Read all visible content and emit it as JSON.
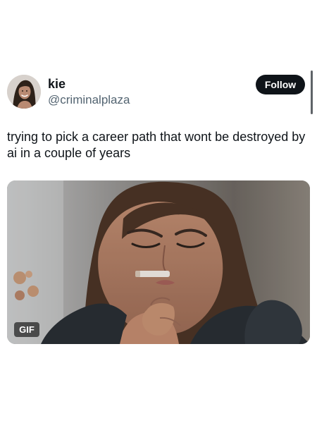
{
  "author": {
    "name": "kie",
    "handle": "@criminalplaza"
  },
  "actions": {
    "follow_label": "Follow"
  },
  "tweet": {
    "text": "trying to pick a career path that wont be destroyed by ai in a couple of years"
  },
  "media": {
    "type_badge": "GIF"
  },
  "colors": {
    "primary_text": "#0f1419",
    "secondary_text": "#536471",
    "follow_button_bg": "#0f1419",
    "follow_button_text": "#ffffff"
  }
}
